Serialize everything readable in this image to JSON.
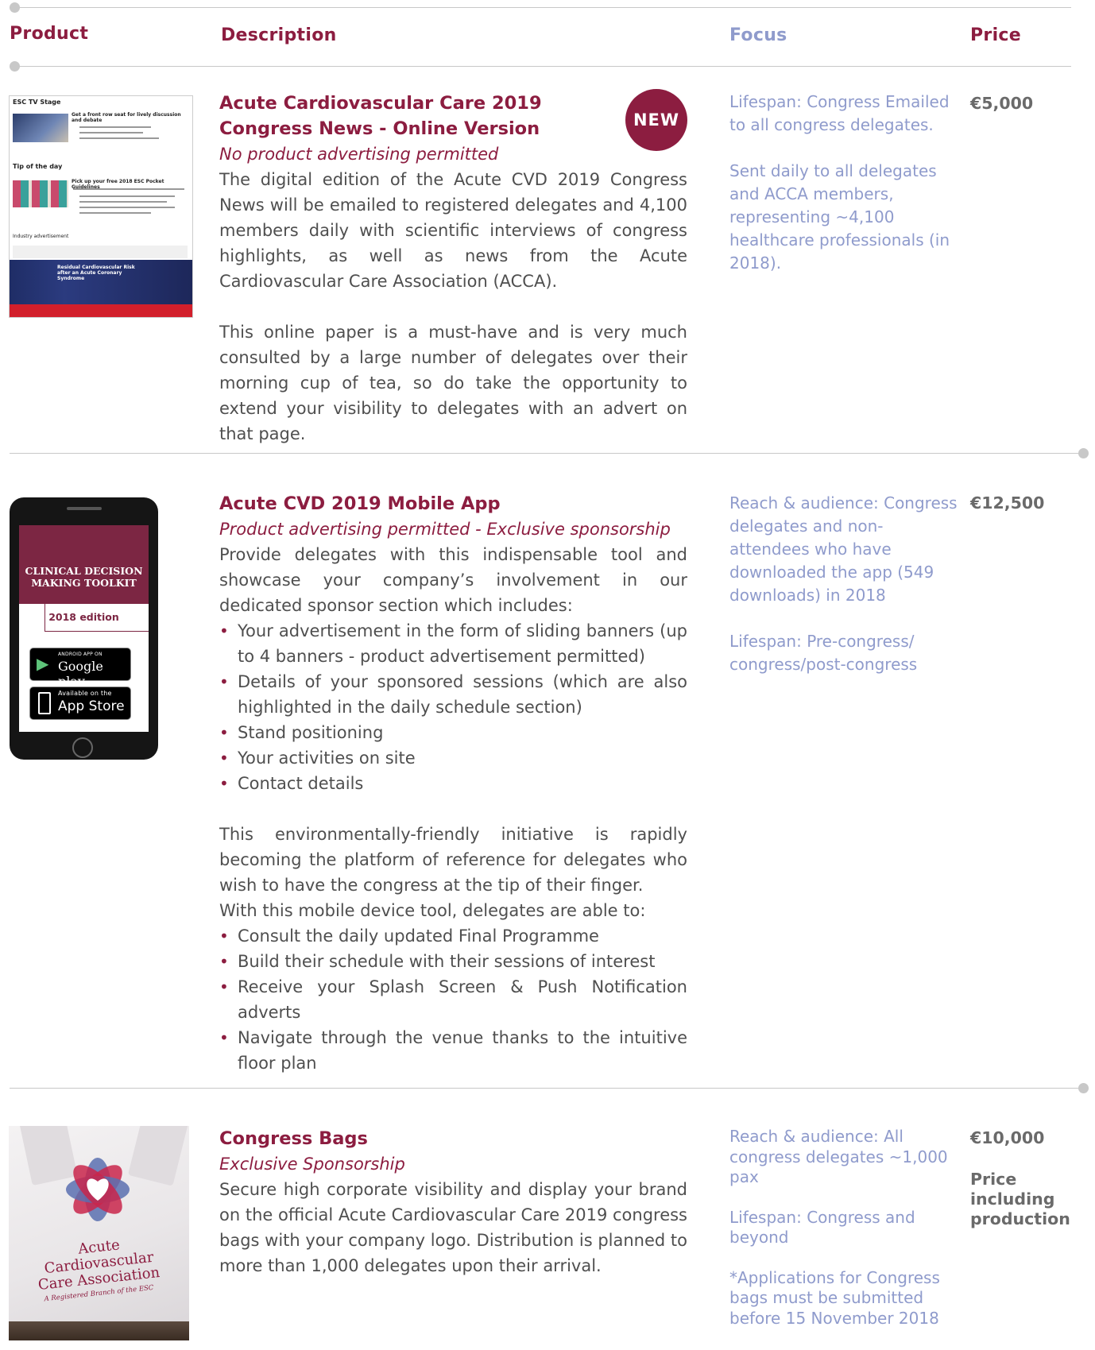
{
  "headers": {
    "product": "Product",
    "description": "Description",
    "focus": "Focus",
    "price": "Price"
  },
  "badge": "NEW",
  "items": [
    {
      "title_line1": "Acute Cardiovascular Care 2019",
      "title_line2": "Congress News - Online Version",
      "subtitle": "No product advertising permitted",
      "paragraphs": [
        "The digital edition of the Acute CVD  2019 Congress News will be emailed to registered delegates and 4,100 members daily with scientific interviews of congress highlights, as well as news from the Acute Cardiovascular Care Association (ACCA).",
        "This online paper is a must-have and is very much consulted by a large number of delegates over their morning cup of tea, so do take the opportunity to extend your visibility to delegates with an advert on that page."
      ],
      "focus": [
        "Lifespan: Congress Emailed to all congress delegates.",
        "Sent daily to all delegates and ACCA members, representing ~4,100 healthcare professionals (in 2018)."
      ],
      "price": "€5,000",
      "thumbnail": {
        "sec1": "ESC TV Stage",
        "sec1_head": "Get a front row seat for lively discussion and debate",
        "sec2": "Tip of the day",
        "sec2_head": "Pick up your free 2018 ESC Pocket Guidelines",
        "sec3": "Industry advertisement",
        "banner": "Residual Cardiovascular Risk after an Acute Coronary Syndrome"
      }
    },
    {
      "title": "Acute CVD 2019 Mobile App",
      "subtitle": "Product advertising permitted - Exclusive sponsorship",
      "intro": "Provide delegates with this indispensable tool and showcase your company’s involvement in our dedicated sponsor section which includes:",
      "bullets1": [
        "Your advertisement in the form of sliding banners (up to 4 banners - product advertisement permitted)",
        "Details of your sponsored sessions (which are also highlighted in the daily schedule section)",
        "Stand positioning",
        "Your activities on site",
        "Contact details"
      ],
      "para2": "This environmentally-friendly initiative is rapidly becoming the platform of reference for delegates who wish to have the congress at the tip of their finger.",
      "para3": "With this mobile device tool, delegates are able to:",
      "bullets2": [
        "Consult the daily updated Final Programme",
        "Build their schedule with their sessions of interest",
        "Receive your Splash Screen & Push Notification adverts",
        "Navigate through the venue thanks to the intuitive floor plan"
      ],
      "focus": [
        "Reach & audience: Congress delegates and non-attendees who have downloaded the app (549 downloads) in 2018",
        "Lifespan: Pre-congress/ congress/post-congress"
      ],
      "price": "€12,500",
      "phone": {
        "line1": "CLINICAL DECISION",
        "line2": "MAKING TOOLKIT",
        "edition": "2018 edition",
        "gp_small": "ANDROID APP ON",
        "gp_big": "Google play",
        "as_small": "Available on the",
        "as_big": "App Store"
      }
    },
    {
      "title": "Congress Bags",
      "subtitle": "Exclusive Sponsorship",
      "paragraph": "Secure high corporate visibility and display your brand on the official Acute Cardiovascular Care 2019 congress bags with your company logo. Distribution is planned to more than 1,000 delegates upon their arrival.",
      "focus": [
        "Reach & audience: All congress delegates ~1,000 pax",
        "Lifespan: Congress and beyond",
        "*Applications for Congress bags must be submitted before 15 November 2018"
      ],
      "price": "€10,000",
      "price_note": "Price including production",
      "bag": {
        "l1": "Acute",
        "l2": "Cardiovascular",
        "l3": "Care Association",
        "l4": "A Registered Branch of the ESC"
      }
    }
  ],
  "colors": {
    "accent": "#8c1d40",
    "focus": "#8f9bcc",
    "rule": "#c8c8c8"
  }
}
